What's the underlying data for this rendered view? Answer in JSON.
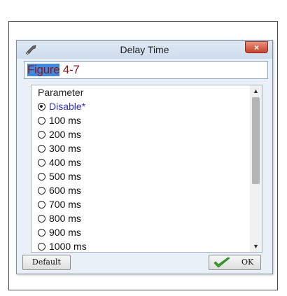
{
  "dialog": {
    "title": "Delay Time",
    "close_label": "×",
    "figure_label": "Figure 4-7"
  },
  "list": {
    "header": "Parameter",
    "items": [
      {
        "label": "Disable*",
        "selected": true
      },
      {
        "label": "100 ms",
        "selected": false
      },
      {
        "label": "200 ms",
        "selected": false
      },
      {
        "label": "300 ms",
        "selected": false
      },
      {
        "label": "400 ms",
        "selected": false
      },
      {
        "label": "500 ms",
        "selected": false
      },
      {
        "label": "600 ms",
        "selected": false
      },
      {
        "label": "700 ms",
        "selected": false
      },
      {
        "label": "800 ms",
        "selected": false
      },
      {
        "label": "900 ms",
        "selected": false
      },
      {
        "label": "1000 ms",
        "selected": false
      }
    ]
  },
  "buttons": {
    "default_label": "Default",
    "ok_label": "OK"
  },
  "colors": {
    "selected_text": "#2f2fd2",
    "figure_label": "#8b1515",
    "check_green": "#3aa12c"
  },
  "icons": {
    "title": "wrench-icon",
    "close": "close-icon",
    "ok": "checkmark-icon"
  }
}
